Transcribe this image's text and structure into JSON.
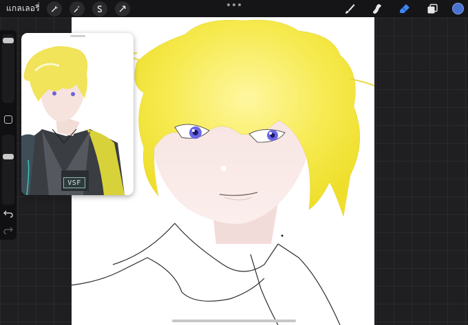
{
  "topbar": {
    "gallery_label": "แกลเลอรี่",
    "left_tools": [
      "wrench-icon",
      "magic-wand-icon",
      "selection-icon",
      "transform-icon"
    ],
    "right_tools": [
      "brush-icon",
      "smudge-icon",
      "eraser-icon",
      "layers-icon"
    ],
    "color": "#4a72d0",
    "active_tool_color": "#3f86f0"
  },
  "reference": {
    "badge_text": "VSF"
  }
}
